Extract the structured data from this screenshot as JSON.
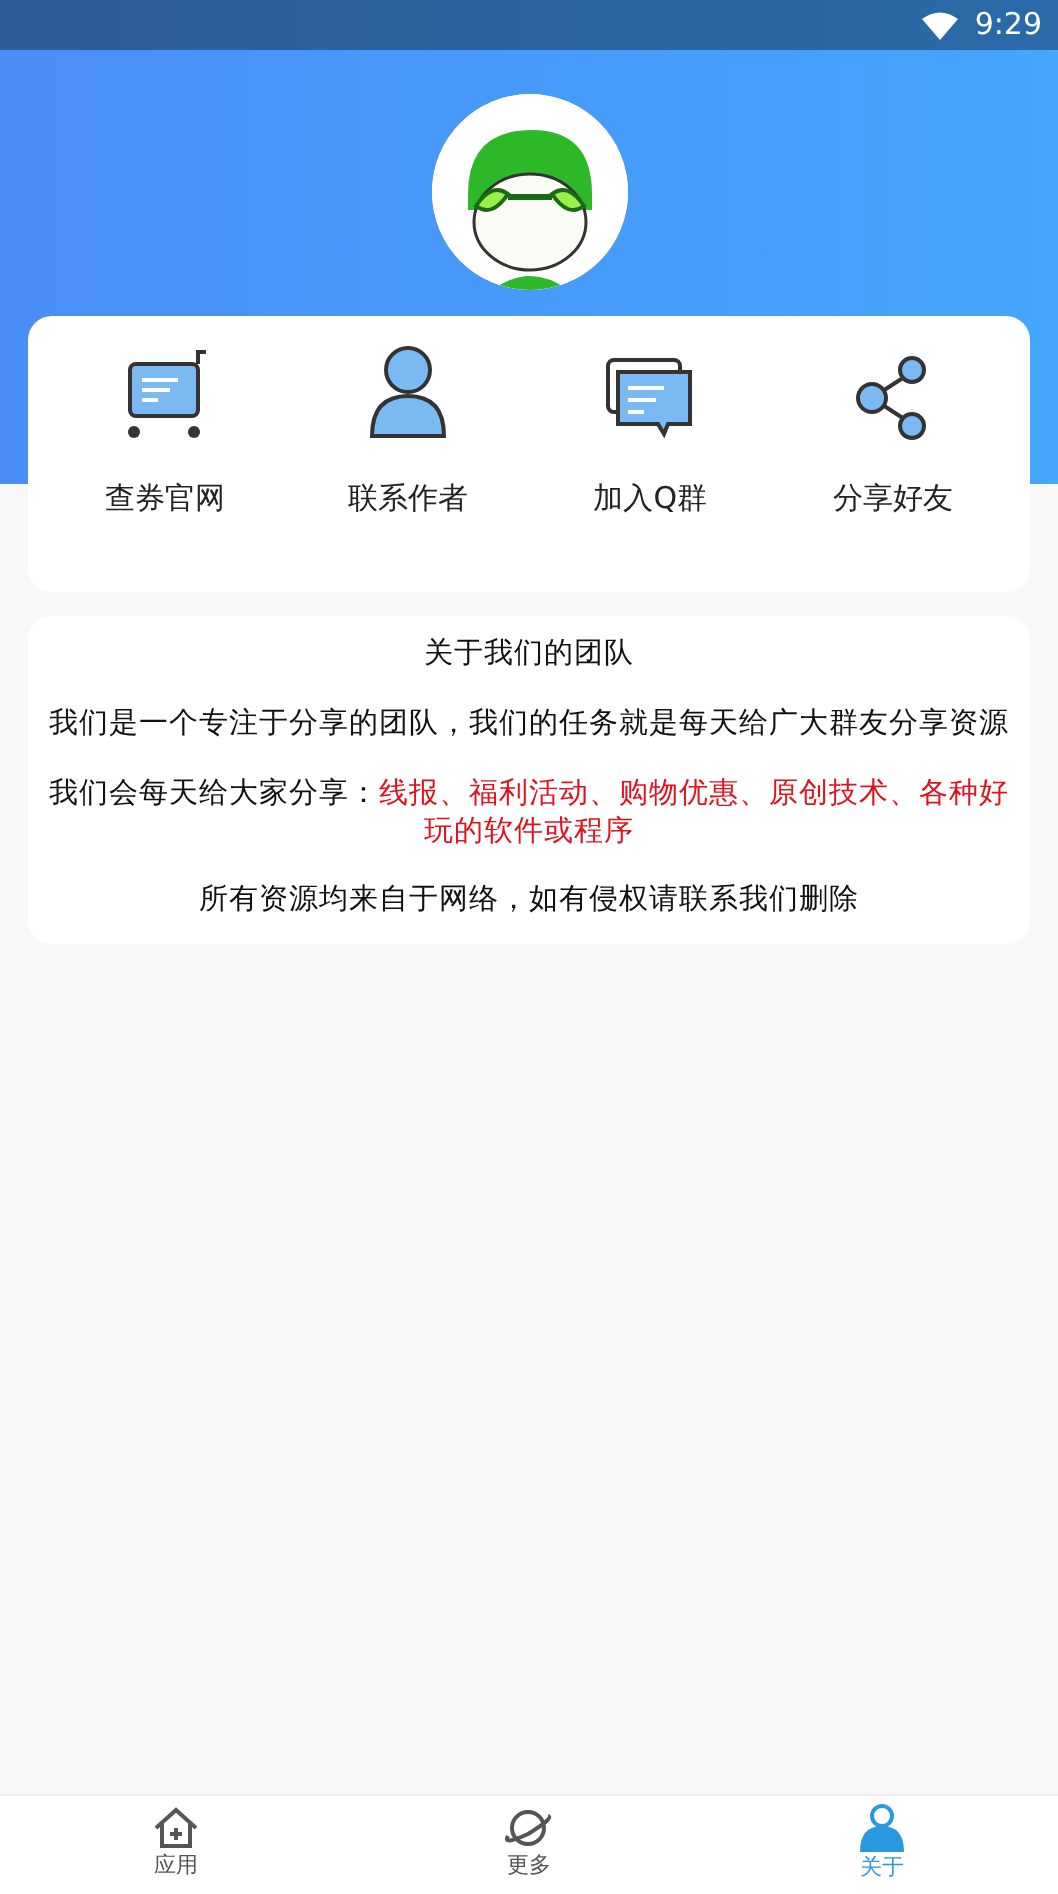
{
  "status_bar": {
    "time": "9:29"
  },
  "actions": [
    {
      "label": "查券官网",
      "kind": "cart"
    },
    {
      "label": "联系作者",
      "kind": "person"
    },
    {
      "label": "加入Q群",
      "kind": "chat"
    },
    {
      "label": "分享好友",
      "kind": "share"
    }
  ],
  "about": {
    "title": "关于我们的团队",
    "paragraphs": [
      [
        {
          "text": "我们是一个专注于分享的团队，我们的任务就是每天给广大群友分享资源",
          "highlight": false
        }
      ],
      [
        {
          "text": "我们会每天给大家分享：",
          "highlight": false
        },
        {
          "text": "线报、福利活动、购物优惠、原创技术、各种好玩的软件或程序",
          "highlight": true
        }
      ],
      [
        {
          "text": "所有资源均来自于网络，如有侵权请联系我们删除",
          "highlight": false
        }
      ]
    ]
  },
  "bottom_nav": [
    {
      "label": "应用",
      "kind": "home",
      "selected": false
    },
    {
      "label": "更多",
      "kind": "planet",
      "selected": false
    },
    {
      "label": "关于",
      "kind": "user",
      "selected": true
    }
  ]
}
